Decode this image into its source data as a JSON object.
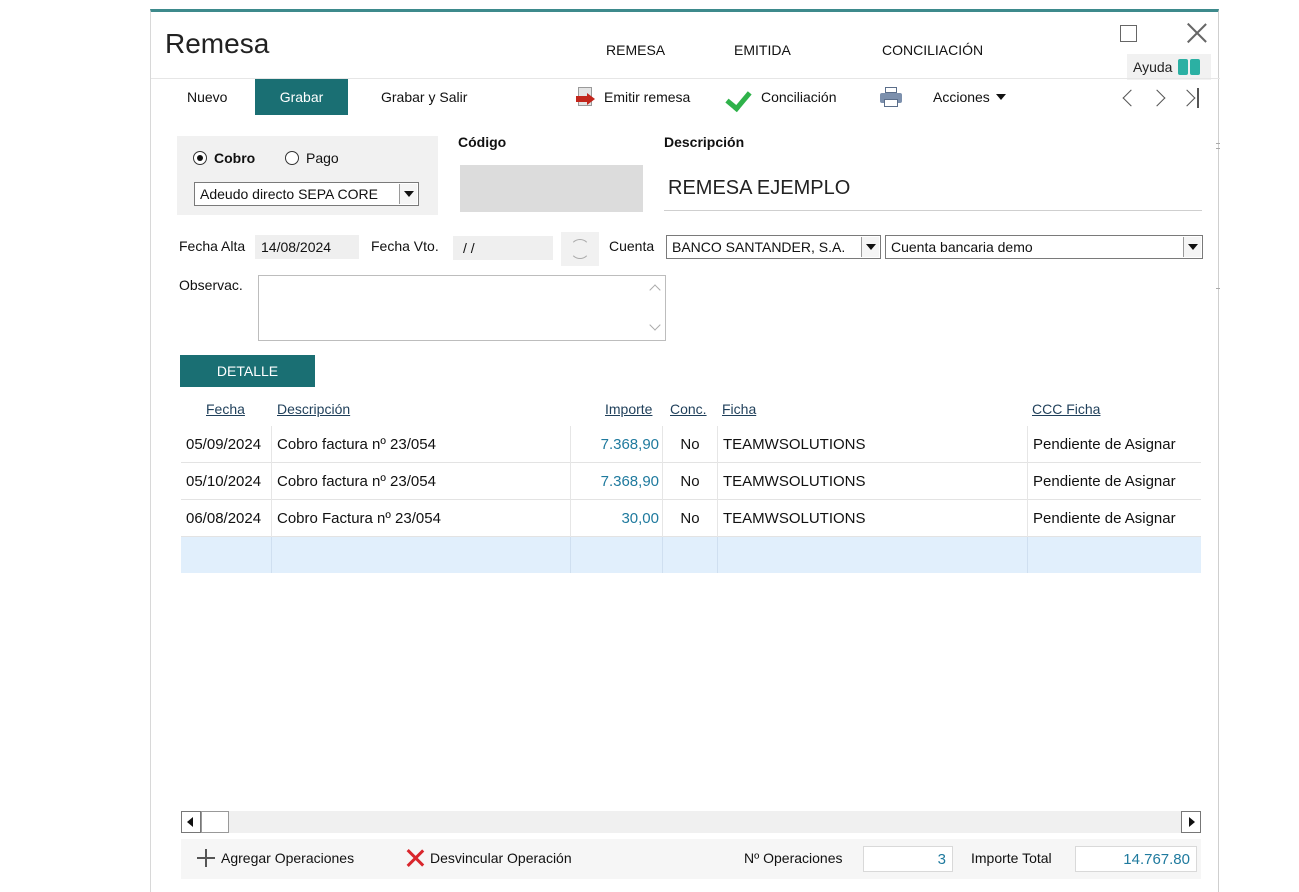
{
  "window": {
    "title": "Remesa",
    "tabs": [
      "REMESA",
      "EMITIDA",
      "CONCILIACIÓN"
    ],
    "help_label": "Ayuda"
  },
  "toolbar": {
    "nuevo": "Nuevo",
    "grabar": "Grabar",
    "grabar_salir": "Grabar y Salir",
    "emitir_remesa": "Emitir remesa",
    "conciliacion": "Conciliación",
    "acciones": "Acciones"
  },
  "form": {
    "tipo": {
      "cobro": "Cobro",
      "pago": "Pago",
      "selected": "Cobro"
    },
    "tipo_remesa": "Adeudo directo SEPA CORE",
    "codigo_label": "Código",
    "codigo_value": "",
    "descripcion_label": "Descripción",
    "descripcion_value": "REMESA EJEMPLO",
    "fecha_alta_label": "Fecha Alta",
    "fecha_alta_value": "14/08/2024",
    "fecha_vto_label": "Fecha Vto.",
    "fecha_vto_value": "/ /",
    "cuenta_label": "Cuenta",
    "cuenta_banco": "BANCO SANTANDER, S.A.",
    "cuenta_bancaria": "Cuenta bancaria demo",
    "observaciones_label": "Observac.",
    "observaciones_value": ""
  },
  "detalle": {
    "tab_label": "DETALLE",
    "columns": [
      "Fecha",
      "Descripción",
      "Importe",
      "Conc.",
      "Ficha",
      "CCC Ficha"
    ],
    "rows": [
      {
        "fecha": "05/09/2024",
        "descripcion": "Cobro factura nº 23/054",
        "importe": "7.368,90",
        "conc": "No",
        "ficha": "TEAMWSOLUTIONS",
        "ccc": "Pendiente de Asignar"
      },
      {
        "fecha": "05/10/2024",
        "descripcion": "Cobro factura nº 23/054",
        "importe": "7.368,90",
        "conc": "No",
        "ficha": "TEAMWSOLUTIONS",
        "ccc": "Pendiente de Asignar"
      },
      {
        "fecha": "06/08/2024",
        "descripcion": "Cobro Factura nº 23/054",
        "importe": "30,00",
        "conc": "No",
        "ficha": "TEAMWSOLUTIONS",
        "ccc": "Pendiente de Asignar"
      }
    ]
  },
  "footer": {
    "agregar": "Agregar Operaciones",
    "desvincular": "Desvincular Operación",
    "n_operaciones_label": "Nº Operaciones",
    "n_operaciones_value": "3",
    "importe_total_label": "Importe Total",
    "importe_total_value": "14.767.80"
  },
  "colors": {
    "accent": "#1a6f73",
    "window_border": "#3d8a8c",
    "number_text": "#1f7a9e",
    "check_green": "#2fb24a",
    "delete_red": "#d9262c",
    "empty_row": "#e1effc"
  },
  "icons": [
    "maximize-icon",
    "close-icon",
    "book-icon",
    "emit-remesa-icon",
    "check-icon",
    "printer-icon",
    "caret-down-icon",
    "prev-icon",
    "next-icon",
    "last-icon",
    "refresh-icon",
    "plus-icon",
    "x-icon"
  ]
}
